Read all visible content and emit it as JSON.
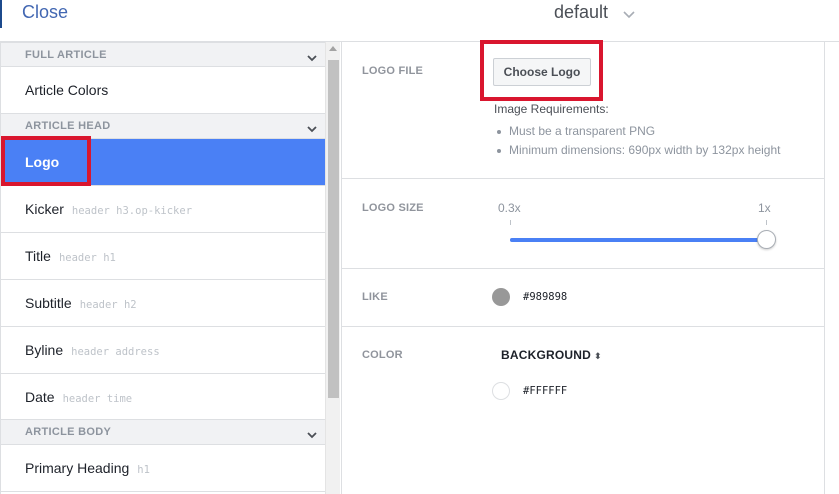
{
  "topbar": {
    "close_label": "Close",
    "style_name": "default"
  },
  "sidebar": {
    "sections": [
      {
        "title": "FULL ARTICLE",
        "items": [
          {
            "name": "Article Colors",
            "selector": ""
          }
        ]
      },
      {
        "title": "ARTICLE HEAD",
        "items": [
          {
            "name": "Logo",
            "selector": ""
          },
          {
            "name": "Kicker",
            "selector": "header h3.op-kicker"
          },
          {
            "name": "Title",
            "selector": "header h1"
          },
          {
            "name": "Subtitle",
            "selector": "header h2"
          },
          {
            "name": "Byline",
            "selector": "header address"
          },
          {
            "name": "Date",
            "selector": "header time"
          }
        ]
      },
      {
        "title": "ARTICLE BODY",
        "items": [
          {
            "name": "Primary Heading",
            "selector": "h1"
          }
        ]
      }
    ],
    "active_item": "Logo"
  },
  "main": {
    "logo_file": {
      "label": "LOGO FILE",
      "button": "Choose Logo",
      "req_title": "Image Requirements:",
      "requirements": [
        "Must be a transparent PNG",
        "Minimum dimensions: 690px width by 132px height"
      ]
    },
    "logo_size": {
      "label": "LOGO SIZE",
      "min_label": "0.3x",
      "max_label": "1x",
      "value_fraction": 1.0
    },
    "like": {
      "label": "LIKE",
      "color": "#989898",
      "hex": "#989898"
    },
    "color": {
      "label": "COLOR",
      "dropdown": "BACKGROUND",
      "swatch_color": "#FFFFFF",
      "hex": "#FFFFFF"
    }
  },
  "colors": {
    "accent": "#4a80f5",
    "link": "#4267b2",
    "highlight": "#d9162e"
  }
}
